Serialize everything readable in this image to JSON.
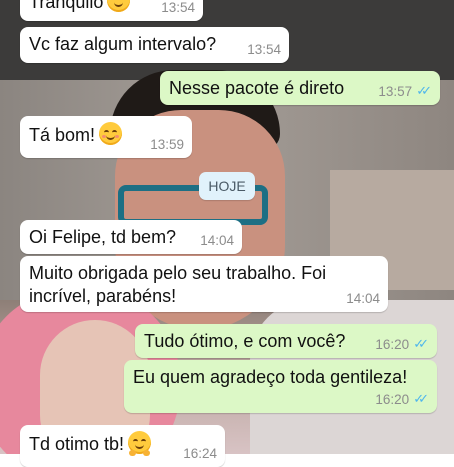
{
  "date_divider": "HOJE",
  "messages": [
    {
      "dir": "in",
      "text": "Tranquilo",
      "emoji": "smiling-face-icon",
      "time": "13:54"
    },
    {
      "dir": "in",
      "text": "Vc faz algum intervalo?",
      "time": "13:54"
    },
    {
      "dir": "out",
      "text": "Nesse pacote é direto",
      "time": "13:57",
      "status": "read"
    },
    {
      "dir": "in",
      "text": "Tá bom!",
      "emoji": "smiling-face-blush-icon",
      "time": "13:59"
    },
    {
      "dir": "in",
      "text": "Oi Felipe, td bem?",
      "time": "14:04"
    },
    {
      "dir": "in",
      "text": "Muito obrigada pelo seu trabalho. Foi\nincrível, parabéns!",
      "time": "14:04"
    },
    {
      "dir": "out",
      "text": "Tudo ótimo, e com você?",
      "time": "16:20",
      "status": "read"
    },
    {
      "dir": "out",
      "text": "Eu quem agradeço toda gentileza!",
      "time": "16:20",
      "status": "read"
    },
    {
      "dir": "in",
      "text": "Td otimo tb!",
      "emoji": "hugging-face-icon",
      "time": "16:24"
    }
  ],
  "colors": {
    "incoming": "#ffffff",
    "outgoing": "#dcf8c6",
    "read_ticks": "#4fb6ec",
    "date_chip": "#e1f2fb"
  }
}
